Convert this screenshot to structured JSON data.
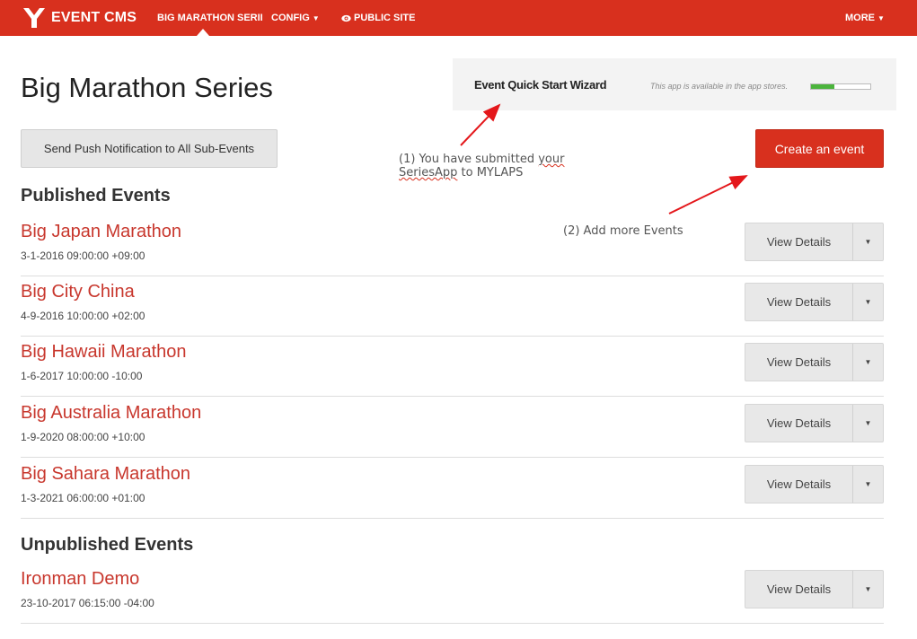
{
  "nav": {
    "brand": "EVENT CMS",
    "items": [
      "BIG MARATHON SERII",
      "CONFIG",
      "PUBLIC SITE"
    ],
    "more": "MORE",
    "caret": "▼"
  },
  "header": {
    "title": "Big Marathon Series"
  },
  "wizard": {
    "title": "Event Quick Start Wizard",
    "note": "This app is available in the app stores.",
    "progress": 0.4
  },
  "actions": {
    "push_label": "Send Push Notification to All Sub-Events",
    "create_label": "Create an event"
  },
  "annotations": {
    "one_a": "(1) You have submitted ",
    "one_b": "your",
    "one_c": "SeriesApp",
    "one_d": " to MYLAPS",
    "two": "(2) Add more Events"
  },
  "published": {
    "heading": "Published Events",
    "events": [
      {
        "name": "Big Japan Marathon",
        "date": "3-1-2016 09:00:00 +09:00"
      },
      {
        "name": "Big City China",
        "date": "4-9-2016 10:00:00 +02:00"
      },
      {
        "name": "Big Hawaii Marathon",
        "date": "1-6-2017 10:00:00 -10:00"
      },
      {
        "name": "Big Australia Marathon",
        "date": "1-9-2020 08:00:00 +10:00"
      },
      {
        "name": "Big Sahara Marathon",
        "date": "1-3-2021 06:00:00 +01:00"
      }
    ]
  },
  "unpublished": {
    "heading": "Unpublished Events",
    "events": [
      {
        "name": "Ironman Demo",
        "date": "23-10-2017 06:15:00 -04:00"
      }
    ]
  },
  "row": {
    "view_label": "View Details",
    "caret": "▼"
  },
  "colors": {
    "brand": "#d8301e",
    "event_link": "#c8372d",
    "progress": "#4bb43c"
  }
}
